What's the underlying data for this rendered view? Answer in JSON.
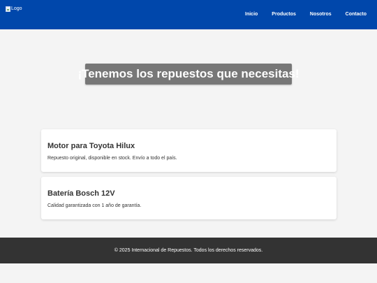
{
  "header": {
    "background": "#0047ab",
    "logo_alt": "Logo",
    "nav": [
      "Inicio",
      "Productos",
      "Nosotros",
      "Contacto"
    ]
  },
  "hero": {
    "text": "¡Tenemos los repuestos que necesitas!"
  },
  "products": [
    {
      "title": "Motor para Toyota Hilux",
      "description": "Repuesto original, disponible en stock. Envío a todo el país."
    },
    {
      "title": "Batería Bosch 12V",
      "description": "Calidad garantizada con 1 año de garantía."
    }
  ],
  "footer": {
    "text": "© 2025 Internacional de Repuestos. Todos los derechos reservados."
  }
}
